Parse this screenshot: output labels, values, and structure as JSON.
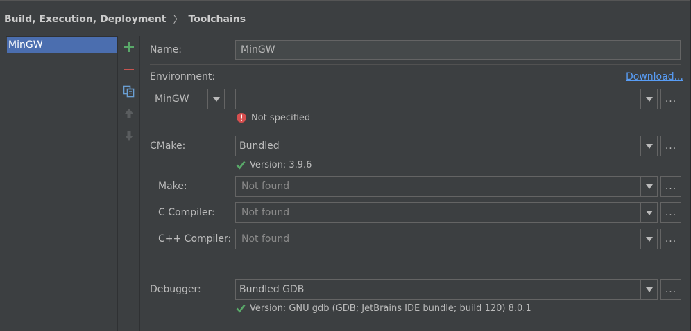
{
  "breadcrumb": {
    "parent": "Build, Execution, Deployment",
    "separator": "〉",
    "current": "Toolchains"
  },
  "toolchain_list": {
    "items": [
      "MinGW"
    ],
    "selected": "MinGW"
  },
  "toolbar": {
    "icons": [
      "add-icon",
      "remove-icon",
      "copy-icon",
      "move-up-icon",
      "move-down-icon"
    ],
    "colors": {
      "add": "#59a869",
      "remove": "#c75450",
      "copy": "#6a9fd4",
      "disabled": "#5a5d5f"
    }
  },
  "form": {
    "name": {
      "label": "Name:",
      "value": "MinGW"
    },
    "environment": {
      "label": "Environment:",
      "download_link": "Download...",
      "type_value": "MinGW",
      "path_value": "",
      "status": "Not specified"
    },
    "cmake": {
      "label": "CMake:",
      "value": "Bundled",
      "status": "Version: 3.9.6"
    },
    "make": {
      "label": "Make:",
      "value": "Not found"
    },
    "c_compiler": {
      "label": "C Compiler:",
      "value": "Not found"
    },
    "cpp_compiler": {
      "label": "C++ Compiler:",
      "value": "Not found"
    },
    "debugger": {
      "label": "Debugger:",
      "value": "Bundled GDB",
      "status": "Version: GNU gdb (GDB; JetBrains IDE bundle; build 120) 8.0.1"
    },
    "browse_label": "..."
  },
  "colors": {
    "background": "#3c3f41",
    "selection": "#4b6eaf",
    "link": "#589df6",
    "ok": "#59a869",
    "error": "#d64f4f"
  }
}
